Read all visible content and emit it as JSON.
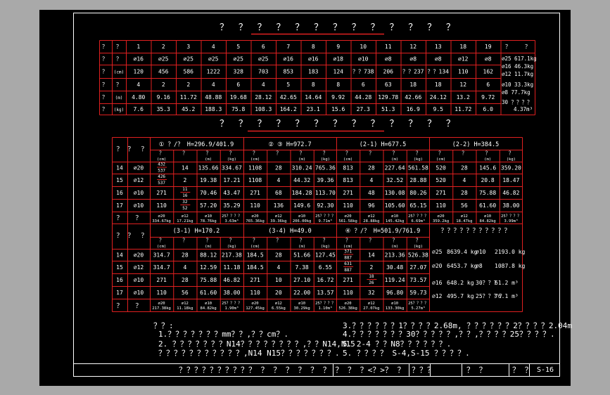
{
  "titles": {
    "table1": "？ ？ ？ ？ ？ ？ ？ ？ ？ ？ ？ ？ ？",
    "table2": "？ ？ ？ ？ ？ ？ ？ ？ ？ ？ ？ ？ ？"
  },
  "table1": {
    "row_labels": [
      [
        "？",
        "？"
      ],
      [
        "？",
        "？"
      ],
      [
        "？",
        "(cm)"
      ],
      [
        "？",
        "？"
      ],
      [
        "？",
        "(m)"
      ],
      [
        "？",
        "(kg)"
      ]
    ],
    "columns": [
      "1",
      "2",
      "3",
      "4",
      "5",
      "6",
      "7",
      "8",
      "9",
      "10",
      "11",
      "12",
      "13",
      "18",
      "19"
    ],
    "rows": [
      [
        "⌀16",
        "⌀25",
        "⌀25",
        "⌀25",
        "⌀25",
        "⌀25",
        "⌀16",
        "⌀16",
        "⌀18",
        "⌀10",
        "⌀8",
        "⌀8",
        "⌀8",
        "⌀12",
        "⌀8"
      ],
      [
        "120",
        "456",
        "586",
        "1222",
        "328",
        "703",
        "853",
        "183",
        "124",
        "？？738",
        "206",
        "？？237",
        "？？134",
        "110",
        "162"
      ],
      [
        "4",
        "2",
        "2",
        "4",
        "6",
        "4",
        "5",
        "8",
        "8",
        "6",
        "63",
        "18",
        "18",
        "12",
        "6"
      ],
      [
        "4.80",
        "9.16",
        "11.72",
        "48.88",
        "19.68",
        "28.12",
        "42.65",
        "14.64",
        "9.92",
        "44.28",
        "129.78",
        "42.66",
        "24.12",
        "13.2",
        "9.72"
      ],
      [
        "7.6",
        "35.3",
        "45.2",
        "188.3",
        "75.8",
        "108.3",
        "164.2",
        "23.1",
        "15.6",
        "27.3",
        "51.3",
        "16.9",
        "9.5",
        "11.72",
        "6.0"
      ]
    ],
    "summary_header": [
      "？",
      "？"
    ],
    "summary": [
      "⌀25  617.1kg",
      "⌀16  46.3kg",
      "⌀12  11.7kg",
      "⌀10  33.3kg",
      "⌀8  77.7kg",
      "30 ？？？？",
      "4.37m³"
    ]
  },
  "table2": {
    "upper_groups": [
      {
        "title": "① ？/？  H=296.9/401.9"
      },
      {
        "title": "②  ③   H=972.7"
      },
      {
        "title": "(2-1)       H=677.5"
      },
      {
        "title": "(2-2)       H=384.5"
      }
    ],
    "lower_groups": [
      {
        "title": "(3-1)       H=170.2"
      },
      {
        "title": "(3-4)     H=49.0"
      },
      {
        "title": "④ ？/？  H=501.9/761.9"
      }
    ],
    "sub_header": [
      "？",
      "？",
      "？",
      "？"
    ],
    "sub_units": [
      "(cm)",
      "",
      "(m)",
      "(kg)"
    ],
    "left_header": [
      "？",
      "？",
      "？"
    ],
    "upper_rows": [
      {
        "no": "14",
        "dia": "⌀20",
        "cells": [
          [
            "432/537",
            "14",
            "135.66",
            "334.67"
          ],
          [
            "1108",
            "28",
            "310.24",
            "765.36"
          ],
          [
            "813",
            "28",
            "227.64",
            "561.58"
          ],
          [
            "520",
            "28",
            "145.6",
            "359.20"
          ]
        ]
      },
      {
        "no": "15",
        "dia": "⌀12",
        "cells": [
          [
            "426/537",
            "2",
            "19.38",
            "17.21"
          ],
          [
            "1108",
            "4",
            "44.32",
            "39.36"
          ],
          [
            "813",
            "4",
            "32.52",
            "28.88"
          ],
          [
            "520",
            "4",
            "20.8",
            "18.47"
          ]
        ]
      },
      {
        "no": "16",
        "dia": "⌀10",
        "cells": [
          [
            "271",
            "11/16",
            "70.46",
            "43.47"
          ],
          [
            "271",
            "68",
            "184.28",
            "113.70"
          ],
          [
            "271",
            "48",
            "130.08",
            "80.26"
          ],
          [
            "271",
            "28",
            "75.88",
            "46.82"
          ]
        ]
      },
      {
        "no": "17",
        "dia": "⌀10",
        "cells": [
          [
            "110",
            "32/52",
            "57.20",
            "35.29"
          ],
          [
            "110",
            "136",
            "149.6",
            "92.30"
          ],
          [
            "110",
            "96",
            "105.60",
            "65.15"
          ],
          [
            "110",
            "56",
            "61.60",
            "38.00"
          ]
        ]
      }
    ],
    "upper_totals": [
      [
        "⌀20 334.67kg",
        "⌀12 17.21kg",
        "⌀10 78.76kg",
        "25？？？？ 3.63m³"
      ],
      [
        "⌀20 765.36kg",
        "⌀12 39.36kg",
        "⌀10 206.00kg",
        "25？？？？ 9.71m³"
      ],
      [
        "⌀20 561.58kg",
        "⌀12 28.88kg",
        "⌀10 145.42kg",
        "25？？？？ 6.69m³"
      ],
      [
        "⌀20 359.2kg",
        "⌀12 18.47kg",
        "⌀10 84.82kg",
        "25？？？？ 3.99m³"
      ]
    ],
    "lower_rows": [
      {
        "no": "14",
        "dia": "⌀20",
        "cells": [
          [
            "314.7",
            "28",
            "88.12",
            "217.38"
          ],
          [
            "184.5",
            "28",
            "51.66",
            "127.45"
          ],
          [
            "371/887",
            "14",
            "213.36",
            "526.38"
          ]
        ]
      },
      {
        "no": "15",
        "dia": "⌀12",
        "cells": [
          [
            "314.7",
            "4",
            "12.59",
            "11.18"
          ],
          [
            "184.5",
            "4",
            "7.38",
            "6.55"
          ],
          [
            "631/887",
            "2",
            "30.48",
            "27.07"
          ]
        ]
      },
      {
        "no": "16",
        "dia": "⌀10",
        "cells": [
          [
            "271",
            "28",
            "75.88",
            "46.82"
          ],
          [
            "271",
            "10",
            "27.10",
            "16.72"
          ],
          [
            "271",
            "18/26",
            "119.24",
            "73.57"
          ]
        ]
      },
      {
        "no": "17",
        "dia": "⌀10",
        "cells": [
          [
            "110",
            "56",
            "61.60",
            "38.00"
          ],
          [
            "110",
            "20",
            "22.00",
            "13.57"
          ],
          [
            "110",
            "32",
            "96.80",
            "59.73"
          ]
        ]
      }
    ],
    "lower_totals": [
      [
        "⌀20 217.38kg",
        "⌀12 11.18kg",
        "⌀10 84.82kg",
        "25？？？？ 1.90m³"
      ],
      [
        "⌀20 127.45kg",
        "⌀12 6.55kg",
        "⌀10 30.29kg",
        "25？？？？ 1.10m³"
      ],
      [
        "⌀20 526.38kg",
        "⌀12 27.07kg",
        "⌀10 133.30kg",
        "25？？？？ 5.27m³"
      ]
    ],
    "grand_header": "？？？？？？？？？？？",
    "grand": [
      [
        "⌀25",
        "8639.4 kg",
        "⌀10",
        "2193.0 kg"
      ],
      [
        "⌀20",
        "6453.7 kg",
        "⌀8",
        "1087.8 kg"
      ],
      [
        "⌀16",
        "648.2 kg",
        "30？？？",
        "61.2 m³"
      ],
      [
        "⌀12",
        "495.7 kg",
        "25？？？？",
        "76.1 m³"
      ]
    ]
  },
  "notes": {
    "header": "？？:",
    "left": [
      "1.？？？？？？？mm？？,？？cm？.",
      "2.  ？？？？？？？N14？？？？？？？？,？？N14,N15",
      "？？？？？？？？？？？,N14  N15？？？？？？？."
    ],
    "right": [
      "3.？？？？？？1？？？？2.68m,    ？？？？？？2？？？？2.04m",
      "4.？？？？？？？30？？？？？,？？,？？？？25？？？？.",
      "5.  2-4  ？？N8？？？？？？.",
      "5.  ？？？？  S-4,S-15  ？？？？."
    ]
  },
  "title_block": [
    "？？？？？？？？？？  ？ ？ ？ ？ ？ ？ ？ ？ ？<？>？ ？",
    "？？？",
    "？  ？",
    "？  ？",
    "S-16"
  ]
}
